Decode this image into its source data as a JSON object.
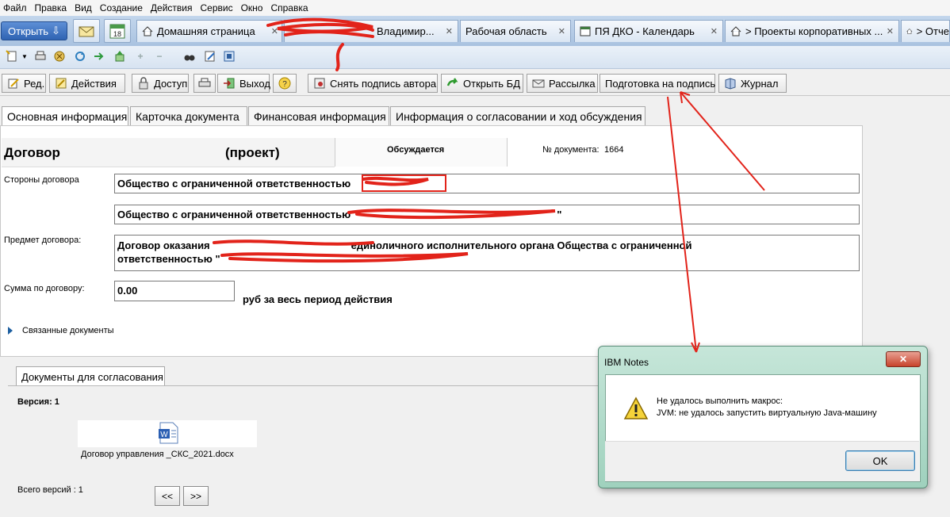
{
  "menu": [
    "Файл",
    "Правка",
    "Вид",
    "Создание",
    "Действия",
    "Сервис",
    "Окно",
    "Справка"
  ],
  "open_button": "Открыть",
  "calendar_day": "18",
  "window_tabs": [
    {
      "label": "Домашняя страница"
    },
    {
      "label": "Владимир..."
    },
    {
      "label": "Рабочая область"
    },
    {
      "label": "ПЯ ДКО - Календарь"
    },
    {
      "label": "> Проекты корпоративных ..."
    },
    {
      "label": "> Отче"
    }
  ],
  "actions": {
    "edit": "Ред.",
    "actions": "Действия",
    "access": "Доступ",
    "exit": "Выход",
    "remove_signature": "Снять подпись автора",
    "open_db": "Открыть БД",
    "mailing": "Рассылка",
    "prepare_signing": "Подготовка на подпись",
    "journal": "Журнал"
  },
  "doc_tabs": [
    "Основная информация",
    "Карточка документа",
    "Финансовая информация",
    "Информация о согласовании и ход обсуждения"
  ],
  "header": {
    "title": "Договор",
    "status_project": "(проект)",
    "state": "Обсуждается",
    "doc_number_label": "№ документа:",
    "doc_number": "1664"
  },
  "form": {
    "parties_label": "Стороны договора",
    "party1": "Общество с ограниченной ответственностью",
    "party2": "Общество с ограниченной ответственностью",
    "party2_suffix": "\"",
    "subject_label": "Предмет договора:",
    "subject_line1": "Договор оказания",
    "subject_line1_end": "единоличного исполнительного органа Общества с ограниченной",
    "subject_line2": "ответственностью \"",
    "sum_label": "Сумма по договору:",
    "sum_value": "0.00",
    "sum_suffix": "руб за весь период действия",
    "related": "Связанные документы"
  },
  "approval": {
    "tab": "Документы для согласования",
    "version_label": "Версия: 1",
    "file_name": "Договор управления _СКС_2021.docx",
    "total_versions": "Всего версий : 1",
    "prev": "<<",
    "next": ">>"
  },
  "dialog": {
    "title": "IBM Notes",
    "line1": "Не удалось выполнить макрос:",
    "line2": "JVM: не удалось запустить виртуальную Java-машину",
    "ok": "OK"
  },
  "colors": {
    "annotation_red": "#e2231a",
    "tab_strip": "#b8cde8",
    "dialog_frame": "#a8d8c6"
  }
}
